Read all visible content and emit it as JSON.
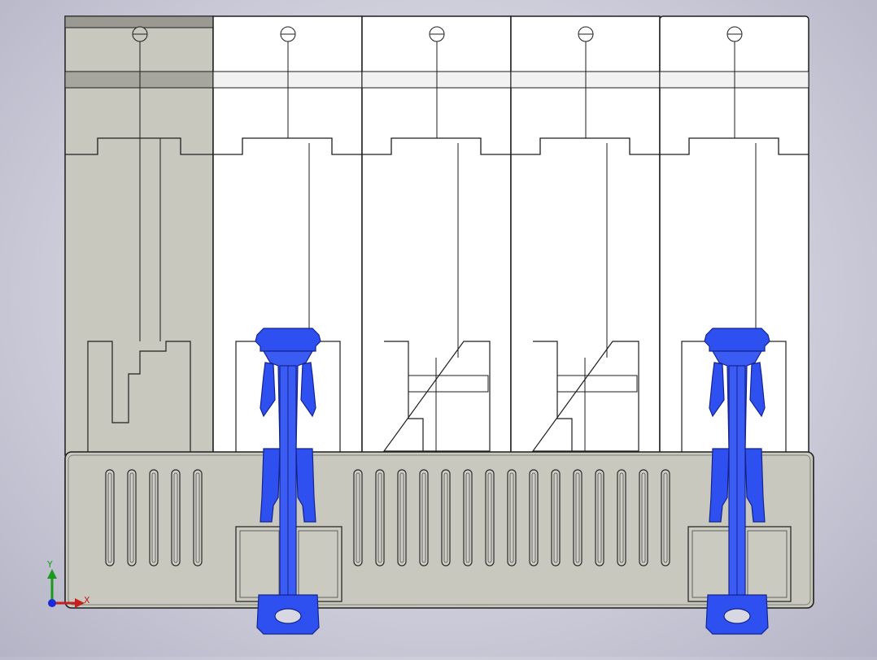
{
  "axes": {
    "x_label": "X",
    "y_label": "Y"
  },
  "colors": {
    "background": "#d4d4e0",
    "housing_grey": "#c8c8be",
    "module_white": "#ffffff",
    "clip_blue": "#2f50f0",
    "outline": "#1e1e1e",
    "axis_x": "#c42020",
    "axis_y": "#1a9a1a",
    "axis_z": "#1a2ad8"
  },
  "model": {
    "grey_module_count": 1,
    "white_module_count": 4,
    "blue_clip_count": 2
  }
}
